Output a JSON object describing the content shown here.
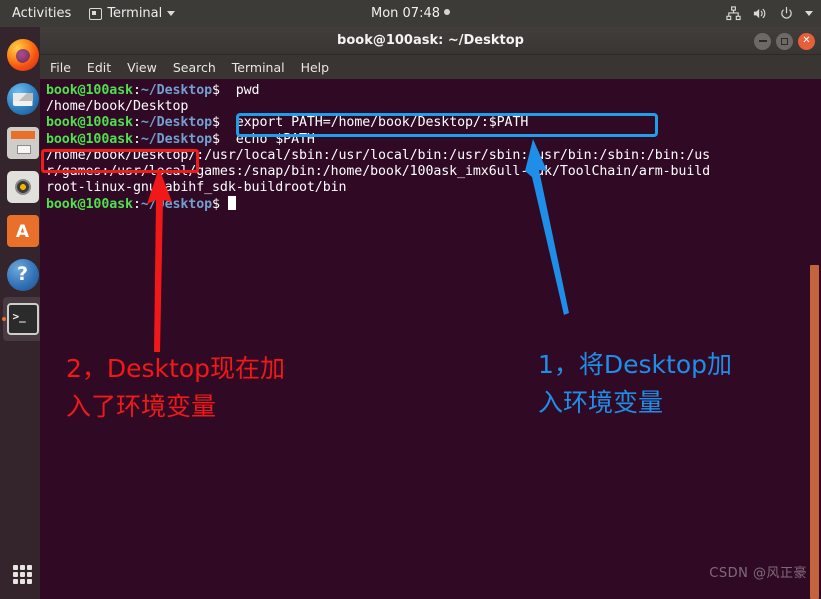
{
  "topbar": {
    "activities": "Activities",
    "app_menu": "Terminal",
    "app_icon": "terminal-window-icon",
    "clock": "Mon 07:48",
    "tray_icons": [
      "network-icon",
      "volume-icon",
      "power-icon",
      "chevron-down-icon"
    ]
  },
  "dock": {
    "items": [
      {
        "name": "firefox",
        "label": "Firefox Web Browser",
        "icon": "firefox-icon",
        "active": false
      },
      {
        "name": "thunderbird",
        "label": "Thunderbird Mail",
        "icon": "mail-icon",
        "active": false
      },
      {
        "name": "files",
        "label": "Files",
        "icon": "files-cabinet-icon",
        "active": false
      },
      {
        "name": "rhythmbox",
        "label": "Rhythmbox",
        "icon": "music-player-icon",
        "active": false
      },
      {
        "name": "ubuntu-software",
        "label": "Ubuntu Software",
        "icon": "software-bag-icon",
        "active": false
      },
      {
        "name": "help",
        "label": "Help",
        "icon": "question-mark-icon",
        "active": false
      },
      {
        "name": "terminal",
        "label": "Terminal",
        "icon": "terminal-icon",
        "active": true
      }
    ],
    "show_apps": "Show Applications",
    "show_apps_icon": "app-grid-icon"
  },
  "window": {
    "title": "book@100ask: ~/Desktop",
    "buttons": {
      "minimize": "minimize-button",
      "maximize": "maximize-button",
      "close": "close-button"
    },
    "menu": [
      "File",
      "Edit",
      "View",
      "Search",
      "Terminal",
      "Help"
    ]
  },
  "terminal": {
    "prompt_user": "book@100ask",
    "prompt_sep": ":",
    "prompt_path": "~/Desktop",
    "prompt_dollar": "$ ",
    "lines": [
      {
        "type": "prompt",
        "command": " pwd"
      },
      {
        "type": "output",
        "text": "/home/book/Desktop"
      },
      {
        "type": "prompt",
        "command": " export PATH=/home/book/Desktop/:$PATH"
      },
      {
        "type": "prompt",
        "command": " echo $PATH"
      },
      {
        "type": "output",
        "text": "/home/book/Desktop/:/usr/local/sbin:/usr/local/bin:/usr/sbin:/usr/bin:/sbin:/bin:/us"
      },
      {
        "type": "output",
        "text": "r/games:/usr/local/games:/snap/bin:/home/book/100ask_imx6ull-sdk/ToolChain/arm-build"
      },
      {
        "type": "output",
        "text": "root-linux-gnueabihf_sdk-buildroot/bin"
      },
      {
        "type": "prompt_cursor",
        "command": " "
      }
    ],
    "scrollbar": "terminal-scrollbar"
  },
  "annotations": {
    "blue_box_label": "export-command-highlight",
    "red_box_label": "desktop-path-highlight",
    "blue_arrow_label": "arrow-pointing-to-export-command",
    "red_arrow_label": "arrow-pointing-to-desktop-path",
    "note_blue": "1，将Desktop加\n入环境变量",
    "note_red": "2，Desktop现在加\n入了环境变量"
  },
  "watermark": "CSDN @风正豪",
  "colors": {
    "terminal_bg": "#300a24",
    "prompt_green": "#4ee04e",
    "prompt_blue": "#729fcf",
    "annotation_red": "#f01818",
    "annotation_blue": "#1f8ee8",
    "scrollbar_orange": "#c4643c",
    "close_button": "#e5603a"
  }
}
